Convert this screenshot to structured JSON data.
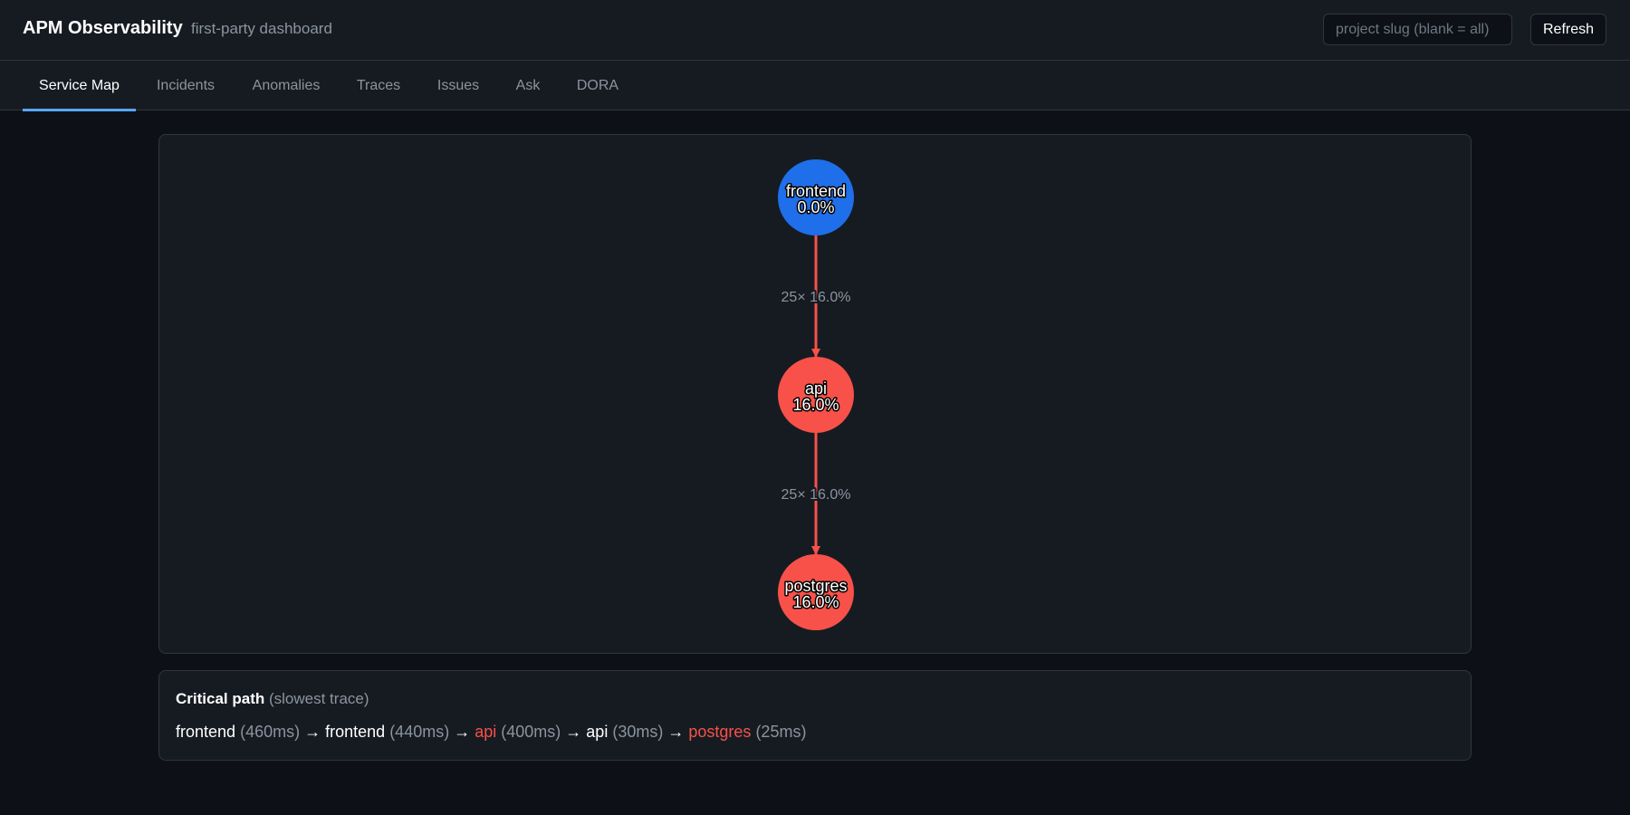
{
  "header": {
    "title": "APM Observability",
    "subtitle": "first-party dashboard",
    "slug_placeholder": "project slug (blank = all)",
    "refresh_label": "Refresh"
  },
  "tabs": [
    {
      "label": "Service Map",
      "active": true
    },
    {
      "label": "Incidents",
      "active": false
    },
    {
      "label": "Anomalies",
      "active": false
    },
    {
      "label": "Traces",
      "active": false
    },
    {
      "label": "Issues",
      "active": false
    },
    {
      "label": "Ask",
      "active": false
    },
    {
      "label": "DORA",
      "active": false
    }
  ],
  "service_map": {
    "nodes": [
      {
        "name": "frontend",
        "error_rate": "0.0%",
        "status": "ok",
        "color": "#1f6feb"
      },
      {
        "name": "api",
        "error_rate": "16.0%",
        "status": "error",
        "color": "#f85149"
      },
      {
        "name": "postgres",
        "error_rate": "16.0%",
        "status": "error",
        "color": "#f85149"
      }
    ],
    "edges": [
      {
        "from": "frontend",
        "to": "api",
        "label": "25× 16.0%",
        "color": "#f85149"
      },
      {
        "from": "api",
        "to": "postgres",
        "label": "25× 16.0%",
        "color": "#f85149"
      }
    ]
  },
  "critical_path": {
    "title": "Critical path",
    "subtitle": "(slowest trace)",
    "steps": [
      {
        "service": "frontend",
        "duration": "(460ms)",
        "error": false
      },
      {
        "service": "frontend",
        "duration": "(440ms)",
        "error": false
      },
      {
        "service": "api",
        "duration": "(400ms)",
        "error": true
      },
      {
        "service": "api",
        "duration": "(30ms)",
        "error": false
      },
      {
        "service": "postgres",
        "duration": "(25ms)",
        "error": true
      }
    ],
    "separator": "→"
  },
  "colors": {
    "accent": "#58a6ff",
    "ok": "#1f6feb",
    "error": "#f85149",
    "muted": "#8b949e"
  }
}
